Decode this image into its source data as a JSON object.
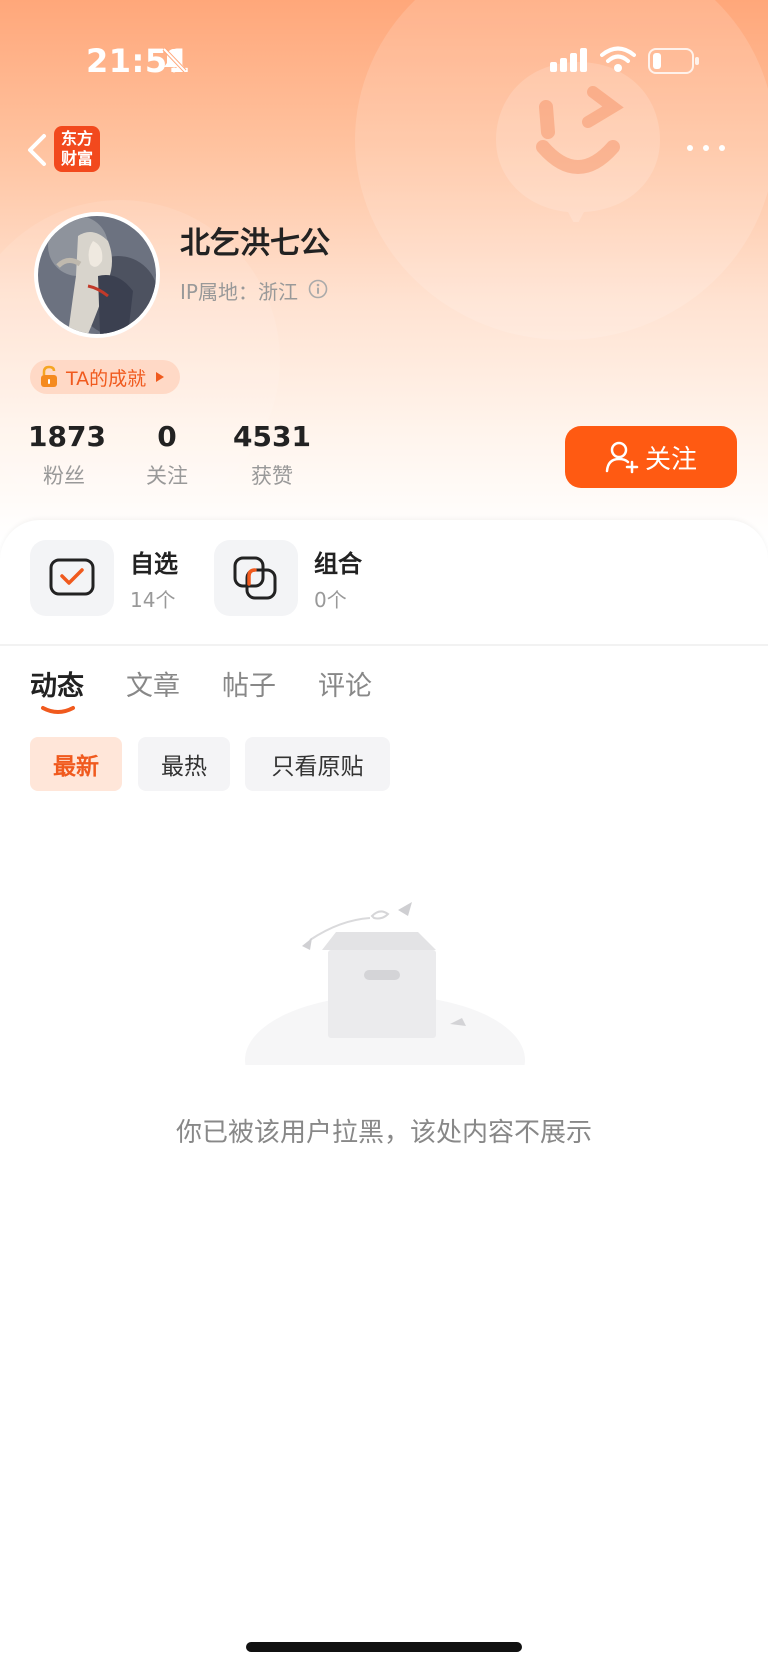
{
  "status_bar": {
    "time": "21:51"
  },
  "header": {
    "logo_text": "东方财富"
  },
  "profile": {
    "username": "北乞洪七公",
    "ip_location": "IP属地：浙江",
    "achievement_label": "TA的成就"
  },
  "stats": [
    {
      "value": "1873",
      "label": "粉丝"
    },
    {
      "value": "0",
      "label": "关注"
    },
    {
      "value": "4531",
      "label": "获赞"
    }
  ],
  "follow_button": {
    "label": "关注"
  },
  "shortcuts": [
    {
      "title": "自选",
      "count": "14个"
    },
    {
      "title": "组合",
      "count": "0个"
    }
  ],
  "tabs": [
    "动态",
    "文章",
    "帖子",
    "评论"
  ],
  "active_tab": "动态",
  "filters": [
    "最新",
    "最热",
    "只看原贴"
  ],
  "active_filter": "最新",
  "empty_state": {
    "message": "你已被该用户拉黑，该处内容不展示"
  },
  "colors": {
    "accent": "#ff5a12",
    "accent_light": "#ffe6d9"
  },
  "icons": [
    "bell-mute-icon",
    "signal-icon",
    "wifi-icon",
    "battery-icon",
    "back-arrow-icon",
    "more-icon",
    "info-icon",
    "lock-icon",
    "add-user-icon",
    "checklist-icon",
    "portfolio-icon",
    "empty-box-icon"
  ]
}
